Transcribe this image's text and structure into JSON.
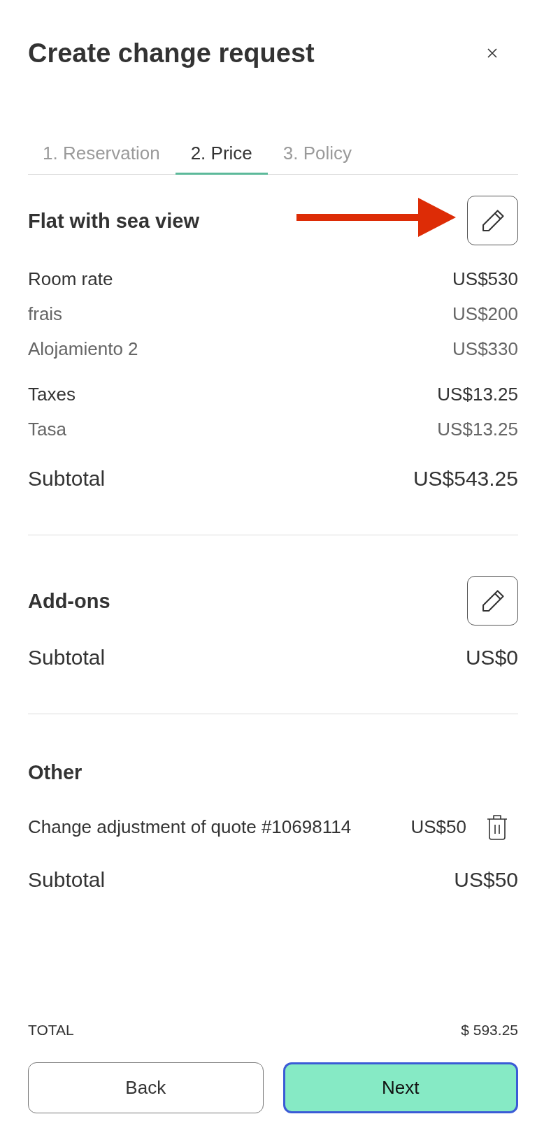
{
  "dialog": {
    "title": "Create change request"
  },
  "tabs": [
    {
      "label": "1. Reservation",
      "selected": false
    },
    {
      "label": "2. Price",
      "selected": true
    },
    {
      "label": "3. Policy",
      "selected": false
    }
  ],
  "sections": [
    {
      "title": "Flat with sea view",
      "editable": true,
      "pointer_arrow": true,
      "lines": [
        {
          "label": "Room rate",
          "amount": "US$530",
          "kind": "group"
        },
        {
          "label": "frais",
          "amount": "US$200",
          "kind": "detail"
        },
        {
          "label": "Alojamiento 2",
          "amount": "US$330",
          "kind": "detail"
        },
        {
          "label": "Taxes",
          "amount": "US$13.25",
          "kind": "group"
        },
        {
          "label": "Tasa",
          "amount": "US$13.25",
          "kind": "detail"
        }
      ],
      "subtotal": {
        "label": "Subtotal",
        "amount": "US$543.25"
      }
    },
    {
      "title": "Add-ons",
      "editable": true,
      "pointer_arrow": false,
      "subtotal": {
        "label": "Subtotal",
        "amount": "US$0"
      }
    },
    {
      "title": "Other",
      "editable": false,
      "pointer_arrow": false,
      "lines": [
        {
          "label": "Change adjustment of quote #10698114",
          "amount": "US$50",
          "kind": "removable"
        }
      ],
      "subtotal": {
        "label": "Subtotal",
        "amount": "US$50"
      }
    }
  ],
  "footer": {
    "total": {
      "label": "TOTAL",
      "amount": "$ 593.25"
    },
    "buttons": [
      {
        "label": "Back",
        "kind": "secondary",
        "focused": false
      },
      {
        "label": "Next",
        "kind": "primary",
        "focused": true
      }
    ]
  }
}
